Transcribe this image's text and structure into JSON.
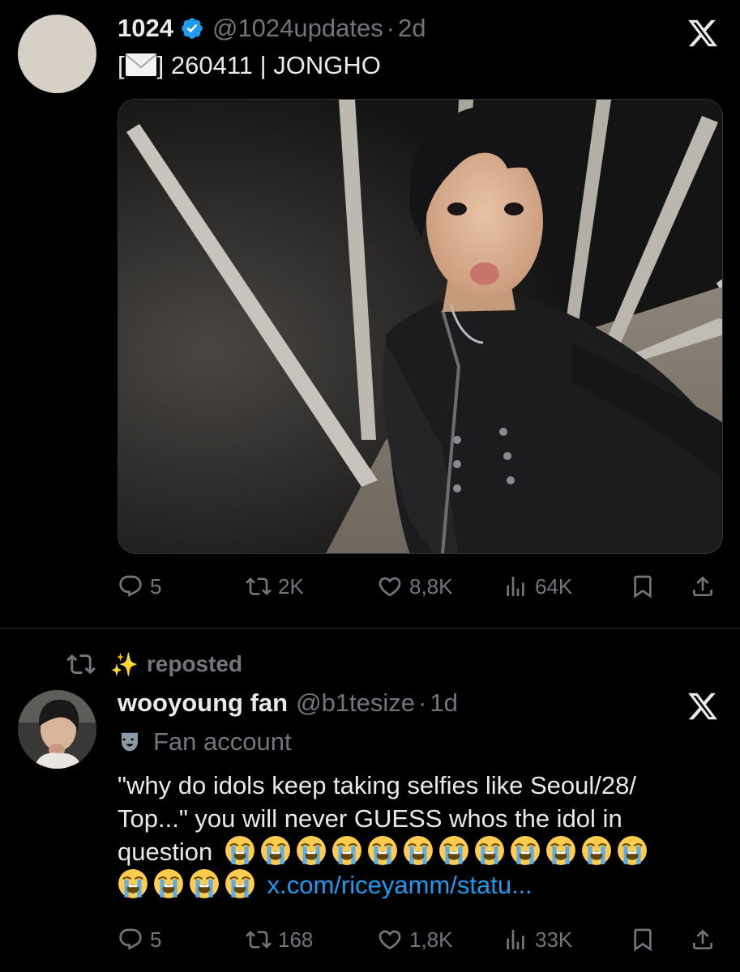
{
  "tweet1": {
    "name": "1024",
    "handle": "@1024updates",
    "dot": "·",
    "time": "2d",
    "text_prefix": "[",
    "text_suffix": "] 260411 | JONGHO",
    "actions": {
      "replies": "5",
      "reposts": "2K",
      "likes": "8,8K",
      "views": "64K"
    }
  },
  "repost_banner": {
    "sparkle": "✨",
    "label": "reposted"
  },
  "tweet2": {
    "name": "wooyoung fan",
    "handle": "@b1tesize",
    "dot": "·",
    "time": "1d",
    "label": "Fan account",
    "line1": "\"why do idols keep taking selfies like Seoul/28/",
    "line2": "Top...\" you will never GUESS whos the idol in",
    "line3": "question",
    "link": "x.com/riceyamm/statu...",
    "emoji_count_line3": 12,
    "emoji_count_line4": 4,
    "actions": {
      "replies": "5",
      "reposts": "168",
      "likes": "1,8K",
      "views": "33K"
    }
  },
  "colors": {
    "background": "#000000",
    "text": "#e7e9ea",
    "muted": "#71767b",
    "link": "#1d9bf0",
    "verified": "#1d9bf0"
  }
}
